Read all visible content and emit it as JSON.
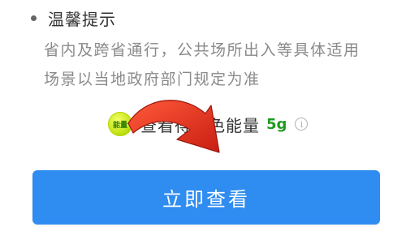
{
  "tips": {
    "title": "温馨提示",
    "line1": "省内及跨省通行，公共场所出入等具体适用",
    "line2": "场景以当地政府部门规定为准"
  },
  "energy": {
    "badge_label": "能量",
    "text": "查看得绿色能量",
    "amount": "5g",
    "info_icon": "info-icon"
  },
  "action": {
    "button_label": "立即查看"
  },
  "colors": {
    "button_bg": "#2f8cf0",
    "energy_amount": "#1e9c1e",
    "arrow": "#e0301e"
  }
}
